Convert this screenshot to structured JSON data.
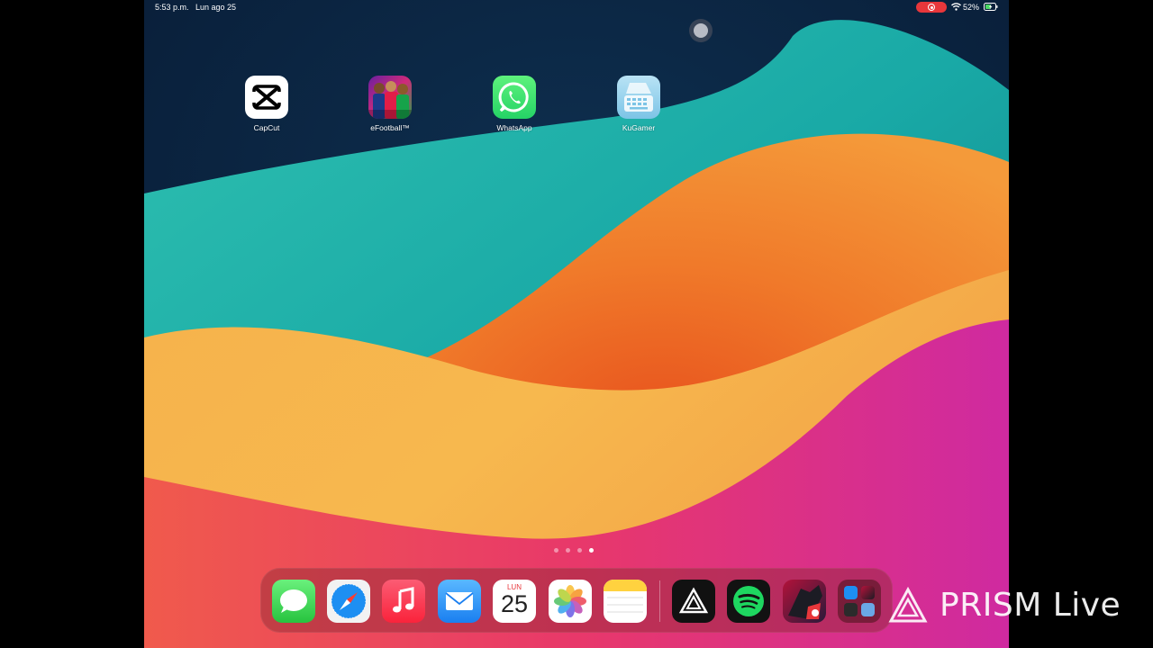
{
  "status_bar": {
    "time": "5:53 p.m.",
    "date": "Lun ago 25",
    "battery": "52%",
    "icons": [
      "screen-record-icon",
      "wifi-icon",
      "battery-charging-icon"
    ]
  },
  "home_apps": [
    {
      "label": "CapCut",
      "icon": "capcut-icon"
    },
    {
      "label": "eFootball™",
      "icon": "efootball-icon"
    },
    {
      "label": "WhatsApp",
      "icon": "whatsapp-icon"
    },
    {
      "label": "KuGamer",
      "icon": "kugamer-icon"
    }
  ],
  "page_indicator": {
    "pages": 4,
    "active": 4
  },
  "dock": {
    "apps": [
      "messages-icon",
      "safari-icon",
      "music-icon",
      "mail-icon",
      "calendar-icon",
      "photos-icon",
      "notes-icon"
    ],
    "recent_apps": [
      "prism-live-icon",
      "spotify-icon",
      "game-icon",
      "app-folder-icon"
    ],
    "calendar_day": "LUN",
    "calendar_date": "25"
  },
  "watermark": {
    "text": "PRISM Live"
  },
  "colors": {
    "accent": "#e8373b",
    "whatsapp": "#25d366",
    "spotify": "#1ed760"
  }
}
